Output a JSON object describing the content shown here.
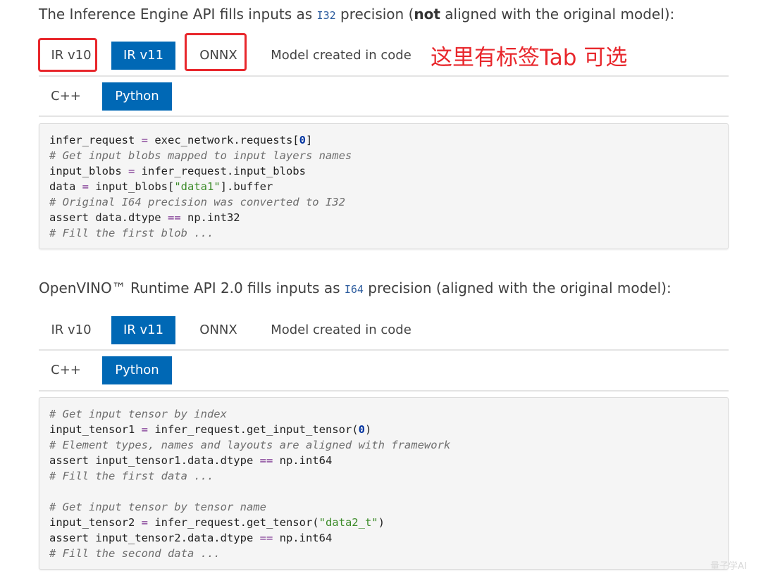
{
  "section1": {
    "intro_before": "The Inference Engine API fills inputs as ",
    "intro_code": "I32",
    "intro_middle": " precision (",
    "intro_bold": "not",
    "intro_after": " aligned with the original model):",
    "model_tabs": [
      "IR v10",
      "IR v11",
      "ONNX",
      "Model created in code"
    ],
    "active_model_tab": "IR v11",
    "lang_tabs": [
      "C++",
      "Python"
    ],
    "active_lang_tab": "Python",
    "annotation": "这里有标签Tab 可选",
    "code_lines": [
      "infer_request = exec_network.requests[0]",
      "# Get input blobs mapped to input layers names",
      "input_blobs = infer_request.input_blobs",
      "data = input_blobs[\"data1\"].buffer",
      "# Original I64 precision was converted to I32",
      "assert data.dtype == np.int32",
      "# Fill the first blob ..."
    ]
  },
  "section2": {
    "intro_before": "OpenVINO™ Runtime API 2.0 fills inputs as ",
    "intro_code": "I64",
    "intro_after": " precision (aligned with the original model):",
    "model_tabs": [
      "IR v10",
      "IR v11",
      "ONNX",
      "Model created in code"
    ],
    "active_model_tab": "IR v11",
    "lang_tabs": [
      "C++",
      "Python"
    ],
    "active_lang_tab": "Python",
    "code_lines": [
      "# Get input tensor by index",
      "input_tensor1 = infer_request.get_input_tensor(0)",
      "# Element types, names and layouts are aligned with framework",
      "assert input_tensor1.data.dtype == np.int64",
      "# Fill the first data ...",
      "",
      "# Get input tensor by tensor name",
      "input_tensor2 = infer_request.get_tensor(\"data2_t\")",
      "assert input_tensor2.data.dtype == np.int64",
      "# Fill the second data ..."
    ]
  },
  "watermark": "量子学AI",
  "colors": {
    "accent": "#0068b5",
    "annotation_red": "#e8272c",
    "code_bg": "#f5f5f5"
  }
}
